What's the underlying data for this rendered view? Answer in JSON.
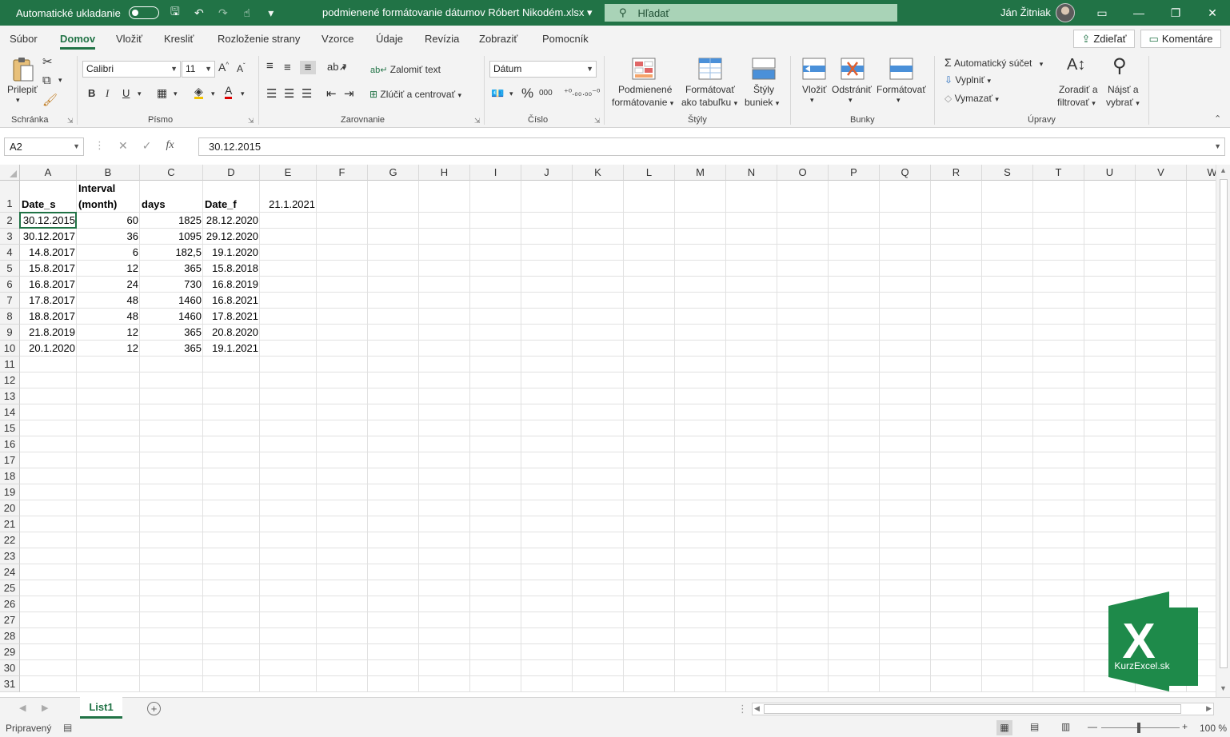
{
  "titlebar": {
    "autosave_label": "Automatické ukladanie",
    "doc_title": "podmienené formátovanie dátumov Róbert Nikodém.xlsx",
    "search_placeholder": "Hľadať",
    "user_name": "Ján Žitniak"
  },
  "tabs": [
    "Súbor",
    "Domov",
    "Vložiť",
    "Kresliť",
    "Rozloženie strany",
    "Vzorce",
    "Údaje",
    "Revízia",
    "Zobraziť",
    "Pomocník"
  ],
  "active_tab": "Domov",
  "share_label": "Zdieľať",
  "comments_label": "Komentáre",
  "ribbon": {
    "clipboard": {
      "paste": "Prilepiť",
      "group": "Schránka"
    },
    "font": {
      "name": "Calibri",
      "size": "11",
      "bold": "B",
      "italic": "I",
      "underline": "U",
      "group": "Písmo"
    },
    "alignment": {
      "wrap": "Zalomiť text",
      "merge": "Zlúčiť a centrovať",
      "group": "Zarovnanie"
    },
    "number": {
      "format": "Dátum",
      "percent": "%",
      "thousands": "000",
      "group": "Číslo"
    },
    "styles": {
      "cond_fmt_1": "Podmienené",
      "cond_fmt_2": "formátovanie",
      "fmt_table_1": "Formátovať",
      "fmt_table_2": "ako tabuľku",
      "cell_styles_1": "Štýly",
      "cell_styles_2": "buniek",
      "group": "Štýly"
    },
    "cells": {
      "insert": "Vložiť",
      "delete": "Odstrániť",
      "format": "Formátovať",
      "group": "Bunky"
    },
    "editing": {
      "autosum": "Automatický súčet",
      "fill": "Vyplniť",
      "clear": "Vymazať",
      "sort_1": "Zoradiť a",
      "sort_2": "filtrovať",
      "find_1": "Nájsť a",
      "find_2": "vybrať",
      "group": "Úpravy"
    }
  },
  "formula_bar": {
    "name_box": "A2",
    "fx": "fx",
    "value": "30.12.2015"
  },
  "grid": {
    "columns": [
      "A",
      "B",
      "C",
      "D",
      "E",
      "F",
      "G",
      "H",
      "I",
      "J",
      "K",
      "L",
      "M",
      "N",
      "O",
      "P",
      "Q",
      "R",
      "S",
      "T",
      "U",
      "V",
      "W"
    ],
    "row_count": 31,
    "header_row": {
      "A": "Date_s",
      "B_line1": "Interval",
      "B_line2": "(month)",
      "C": "days",
      "D": "Date_f",
      "E": "21.1.2021"
    },
    "rows": [
      [
        "30.12.2015",
        "60",
        "1825",
        "28.12.2020"
      ],
      [
        "30.12.2017",
        "36",
        "1095",
        "29.12.2020"
      ],
      [
        "14.8.2017",
        "6",
        "182,5",
        "19.1.2020"
      ],
      [
        "15.8.2017",
        "12",
        "365",
        "15.8.2018"
      ],
      [
        "16.8.2017",
        "24",
        "730",
        "16.8.2019"
      ],
      [
        "17.8.2017",
        "48",
        "1460",
        "16.8.2021"
      ],
      [
        "18.8.2017",
        "48",
        "1460",
        "17.8.2021"
      ],
      [
        "21.8.2019",
        "12",
        "365",
        "20.8.2020"
      ],
      [
        "20.1.2020",
        "12",
        "365",
        "19.1.2021"
      ]
    ]
  },
  "sheet_tab": "List1",
  "status": {
    "ready": "Pripravený",
    "zoom": "100 %"
  },
  "logo_text": "KurzExcel.sk",
  "logo_letter": "X",
  "colors": {
    "excel_green": "#217346",
    "logo_green": "#1e8a4a"
  }
}
